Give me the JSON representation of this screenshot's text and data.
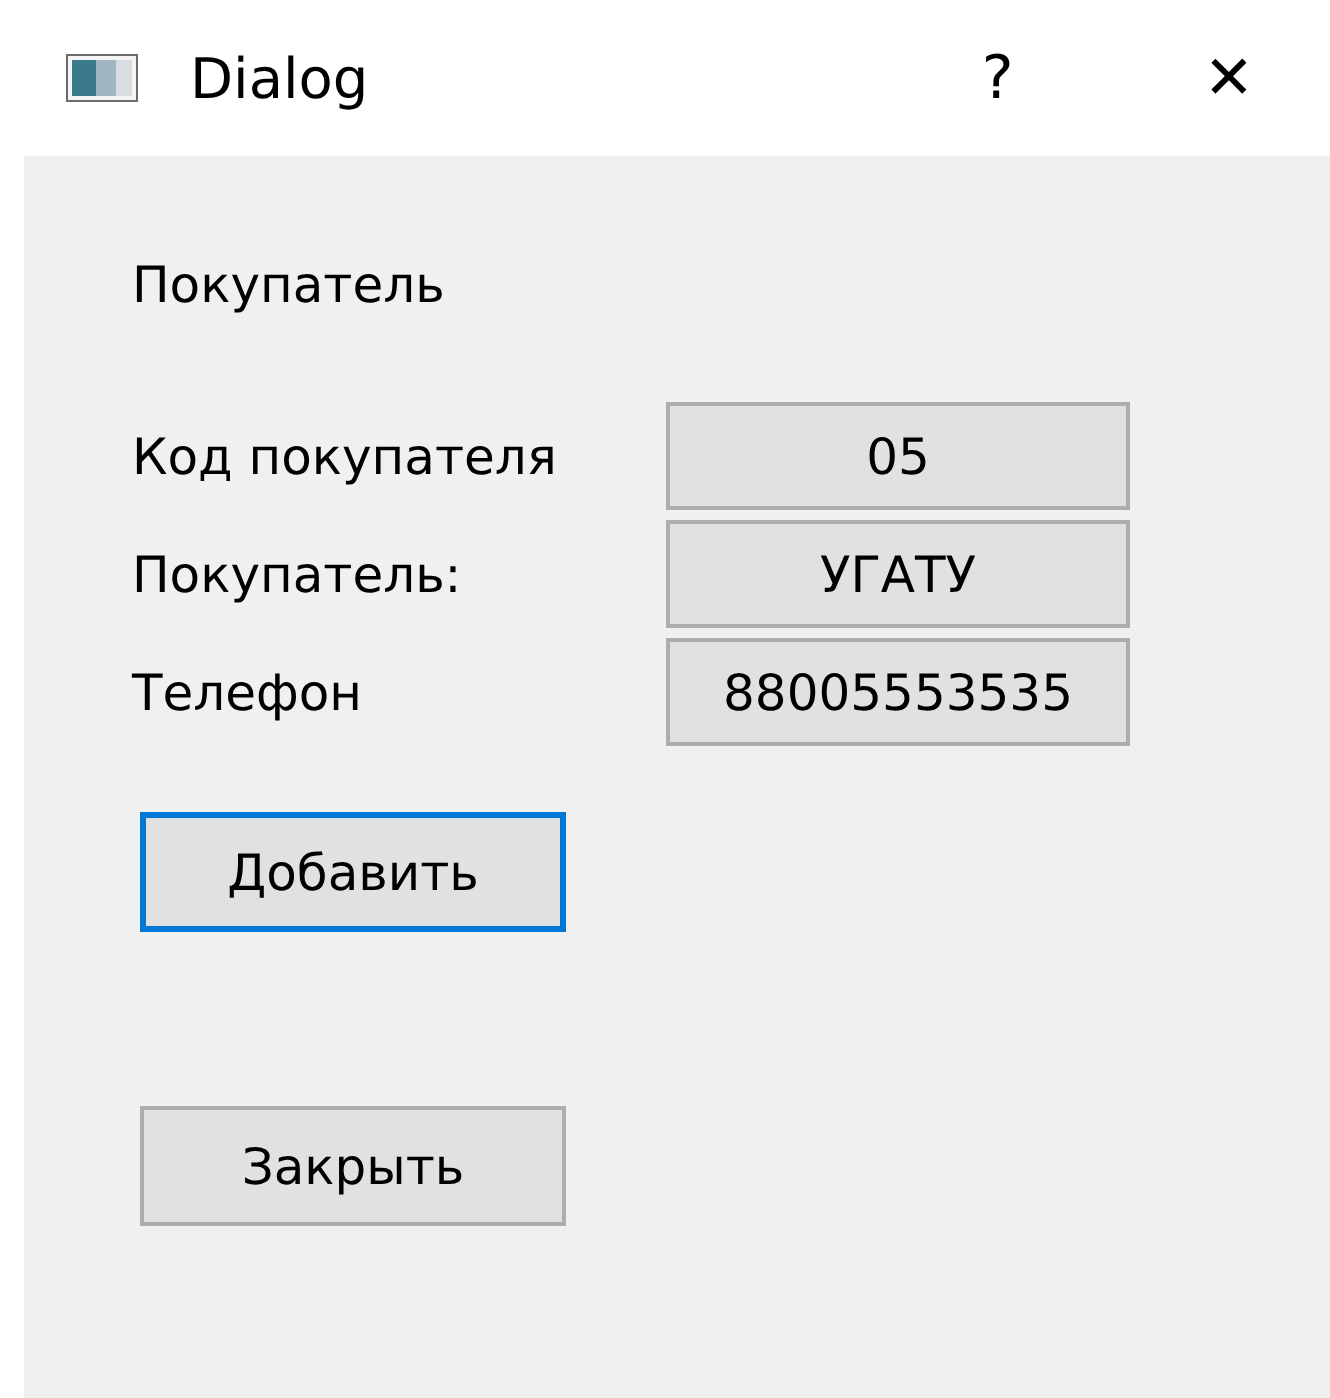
{
  "window": {
    "title": "Dialog",
    "help": "?",
    "close": "✕"
  },
  "heading": "Покупатель",
  "fields": [
    {
      "label": "Код покупателя",
      "value": "05"
    },
    {
      "label": "Покупатель:",
      "value": "УГАТУ"
    },
    {
      "label": "Телефон",
      "value": "88005553535"
    }
  ],
  "buttons": [
    {
      "label": "Добавить",
      "focused": true
    },
    {
      "label": "Закрыть",
      "focused": false
    }
  ]
}
